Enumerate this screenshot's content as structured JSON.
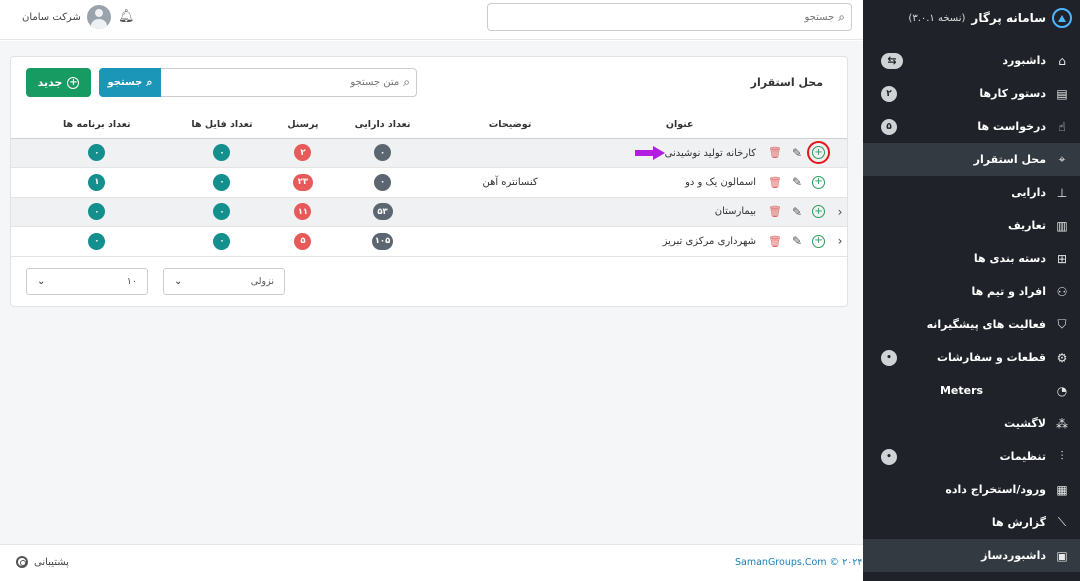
{
  "brand": {
    "title": "سامانه پرگار",
    "version": "(نسخه ۳.۰.۱)"
  },
  "sidebar": {
    "items": [
      {
        "label": "داشبورد",
        "icon": "home-icon",
        "badge": "⇆"
      },
      {
        "label": "دستور کارها",
        "icon": "clipboard-icon",
        "badge": "۲"
      },
      {
        "label": "درخواست ها",
        "icon": "hand-pointer-icon",
        "badge": "۵"
      },
      {
        "label": "محل استقرار",
        "icon": "map-pin-icon",
        "badge": ""
      },
      {
        "label": "دارایی",
        "icon": "crane-icon",
        "badge": ""
      },
      {
        "label": "تعاریف",
        "icon": "book-icon",
        "badge": ""
      },
      {
        "label": "دسته بندی ها",
        "icon": "grid-icon",
        "badge": ""
      },
      {
        "label": "افراد و تیم ها",
        "icon": "users-icon",
        "badge": ""
      },
      {
        "label": "فعالیت های پیشگیرانه",
        "icon": "shield-icon",
        "badge": ""
      },
      {
        "label": "قطعات و سفارشات",
        "icon": "gear-icon",
        "badge": "•"
      },
      {
        "label": "Meters",
        "icon": "gauge-icon",
        "badge": ""
      },
      {
        "label": "لاگشیت",
        "icon": "route-icon",
        "badge": ""
      },
      {
        "label": "تنظیمات",
        "icon": "sliders-icon",
        "badge": "•"
      },
      {
        "label": "ورود/استخراج داده",
        "icon": "books-icon",
        "badge": ""
      },
      {
        "label": "گزارش ها",
        "icon": "chart-line-icon",
        "badge": ""
      },
      {
        "label": "داشبوردساز",
        "icon": "layout-icon",
        "badge": ""
      }
    ]
  },
  "header": {
    "search_placeholder": "جستجو",
    "user_name": "شرکت سامان"
  },
  "main": {
    "title": "محل استقرار",
    "new_label": "جدید",
    "search_label": "جستجو",
    "search_placeholder": "متن جستجو",
    "columns": [
      "عنوان",
      "توضیحات",
      "تعداد دارایی",
      "پرسنل",
      "تعداد فایل ها",
      "تعداد برنامه ها"
    ],
    "rows": [
      {
        "title": "کارخانه تولید نوشیدنی",
        "desc": "",
        "assets": "۰",
        "staff": "۲",
        "files": "۰",
        "programs": "۰"
      },
      {
        "title": "اسمالون یک و دو",
        "desc": "کنسانتره آهن",
        "assets": "۰",
        "staff": "۲۳",
        "files": "۰",
        "programs": "۱"
      },
      {
        "title": "بیمارستان",
        "desc": "",
        "assets": "۵۳",
        "staff": "۱۱",
        "files": "۰",
        "programs": "۰"
      },
      {
        "title": "شهرداری مرکزی تبریز",
        "desc": "",
        "assets": "۱۰۵",
        "staff": "۵",
        "files": "۰",
        "programs": "۰"
      }
    ],
    "sort_value": "نزولی",
    "page_size": "۱۰"
  },
  "footer": {
    "copyright": "SamanGroups.Com © ۲۰۲۴",
    "support": "پشتیبانی"
  }
}
